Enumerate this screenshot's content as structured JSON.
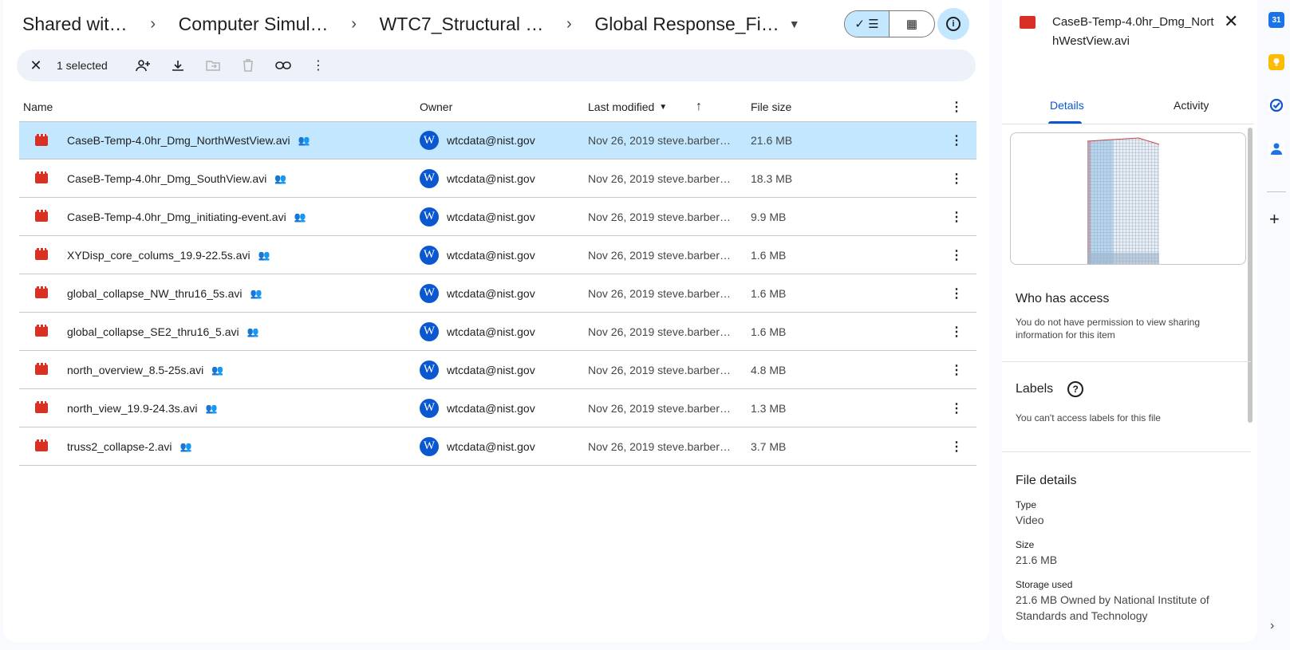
{
  "breadcrumb": [
    "Shared wit…",
    "Computer Simul…",
    "WTC7_Structural …",
    "Global Response_Fi…"
  ],
  "toolbar": {
    "selected_count": "1 selected"
  },
  "columns": {
    "name": "Name",
    "owner": "Owner",
    "modified": "Last modified",
    "size": "File size"
  },
  "files": [
    {
      "name": "CaseB-Temp-4.0hr_Dmg_NorthWestView.avi",
      "owner": "wtcdata@nist.gov",
      "modified": "Nov 26, 2019 steve.barber…",
      "size": "21.6 MB"
    },
    {
      "name": "CaseB-Temp-4.0hr_Dmg_SouthView.avi",
      "owner": "wtcdata@nist.gov",
      "modified": "Nov 26, 2019 steve.barber…",
      "size": "18.3 MB"
    },
    {
      "name": "CaseB-Temp-4.0hr_Dmg_initiating-event.avi",
      "owner": "wtcdata@nist.gov",
      "modified": "Nov 26, 2019 steve.barber…",
      "size": "9.9 MB"
    },
    {
      "name": "XYDisp_core_colums_19.9-22.5s.avi",
      "owner": "wtcdata@nist.gov",
      "modified": "Nov 26, 2019 steve.barber…",
      "size": "1.6 MB"
    },
    {
      "name": "global_collapse_NW_thru16_5s.avi",
      "owner": "wtcdata@nist.gov",
      "modified": "Nov 26, 2019 steve.barber…",
      "size": "1.6 MB"
    },
    {
      "name": "global_collapse_SE2_thru16_5.avi",
      "owner": "wtcdata@nist.gov",
      "modified": "Nov 26, 2019 steve.barber…",
      "size": "1.6 MB"
    },
    {
      "name": "north_overview_8.5-25s.avi",
      "owner": "wtcdata@nist.gov",
      "modified": "Nov 26, 2019 steve.barber…",
      "size": "4.8 MB"
    },
    {
      "name": "north_view_19.9-24.3s.avi",
      "owner": "wtcdata@nist.gov",
      "modified": "Nov 26, 2019 steve.barber…",
      "size": "1.3 MB"
    },
    {
      "name": "truss2_collapse-2.avi",
      "owner": "wtcdata@nist.gov",
      "modified": "Nov 26, 2019 steve.barber…",
      "size": "3.7 MB"
    }
  ],
  "owner_avatar_letter": "W",
  "panel": {
    "title": "CaseB-Temp-4.0hr_Dmg_NorthWestView.avi",
    "tabs": [
      "Details",
      "Activity"
    ],
    "access_title": "Who has access",
    "access_text": "You do not have permission to view sharing information for this item",
    "labels_title": "Labels",
    "labels_text": "You can't access labels for this file",
    "file_details_title": "File details",
    "type_label": "Type",
    "type_value": "Video",
    "size_label": "Size",
    "size_value": "21.6 MB",
    "storage_label": "Storage used",
    "storage_value": "21.6 MB Owned by National Institute of Standards and Technology"
  },
  "rail": {
    "calendar_day": "31"
  },
  "colors": {
    "accent": "#0b57d0",
    "selected_row": "#c2e7ff",
    "video_icon": "#d93025"
  }
}
